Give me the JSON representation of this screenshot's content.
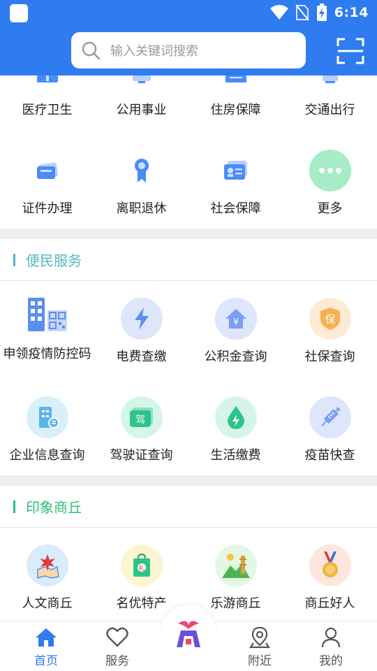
{
  "status_bar": {
    "time": "6:14"
  },
  "search": {
    "placeholder": "输入关键词搜索"
  },
  "top_grid": {
    "row1": [
      {
        "label": "医疗卫生",
        "icon": "medical-icon"
      },
      {
        "label": "公用事业",
        "icon": "utility-icon"
      },
      {
        "label": "住房保障",
        "icon": "housing-icon"
      },
      {
        "label": "交通出行",
        "icon": "traffic-icon"
      }
    ],
    "row2": [
      {
        "label": "证件办理",
        "icon": "id-card-icon"
      },
      {
        "label": "离职退休",
        "icon": "retire-medal-icon"
      },
      {
        "label": "社会保障",
        "icon": "social-security-card-icon"
      },
      {
        "label": "更多",
        "icon": "more-dots-icon"
      }
    ]
  },
  "convenience": {
    "title": "便民服务",
    "accent": "#4fb7c4",
    "row1": [
      {
        "label": "申领疫情防控码",
        "icon": "building-qr-icon"
      },
      {
        "label": "电费查缴",
        "icon": "lightning-icon"
      },
      {
        "label": "公积金查询",
        "icon": "house-yuan-icon"
      },
      {
        "label": "社保查询",
        "icon": "shield-bao-icon"
      }
    ],
    "row2": [
      {
        "label": "企业信息查询",
        "icon": "enterprise-icon"
      },
      {
        "label": "驾驶证查询",
        "icon": "license-jia-icon"
      },
      {
        "label": "生活缴费",
        "icon": "water-drop-icon"
      },
      {
        "label": "疫苗快查",
        "icon": "syringe-icon"
      }
    ]
  },
  "impression": {
    "title": "印象商丘",
    "accent": "#2dbf7a",
    "row1": [
      {
        "label": "人文商丘",
        "icon": "culture-map-icon"
      },
      {
        "label": "名优特产",
        "icon": "gift-bag-icon"
      },
      {
        "label": "乐游商丘",
        "icon": "landscape-tower-icon"
      },
      {
        "label": "商丘好人",
        "icon": "medal-icon"
      }
    ]
  },
  "glyphs": {
    "yuan": "¥",
    "bao": "保",
    "jia": "驾",
    "li": "礼"
  },
  "bottom_nav": {
    "home": "首页",
    "service": "服务",
    "nearby": "附近",
    "mine": "我的"
  },
  "colors": {
    "primary": "#2f7bf0",
    "more_bg": "#a6ecc6",
    "gap": "#eeeeee"
  }
}
